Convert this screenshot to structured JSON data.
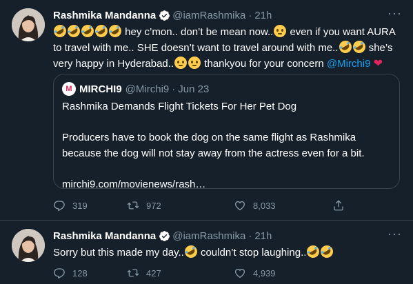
{
  "tweets": [
    {
      "author_name": "Rashmika Mandanna",
      "handle": "@iamRashmika",
      "separator": "·",
      "time": "21h",
      "text": {
        "part1": " hey c’mon.. don’t be mean now..",
        "part2": " even if you want AURA to travel with me.. SHE doesn’t want to travel around with me..",
        "part3": " she’s very happy in Hyderabad..",
        "part4": " thankyou for your concern ",
        "mention": "@Mirchi9"
      },
      "quote": {
        "author_name": "MIRCHI9",
        "handle": "@Mirchi9",
        "separator": "·",
        "date": "Jun 23",
        "headline": "Rashmika Demands Flight Tickets For Her Pet Dog",
        "paragraph": "Producers have to book the dog on the same flight as Rashmika because the dog will not stay away from the actress even for a bit.",
        "link": "mirchi9.com/movienews/rash…"
      },
      "replies": "319",
      "retweets": "972",
      "likes": "8,033"
    },
    {
      "author_name": "Rashmika Mandanna",
      "handle": "@iamRashmika",
      "separator": "·",
      "time": "21h",
      "text": {
        "part1": "Sorry but this made my day..",
        "part2": " couldn’t stop laughing.."
      },
      "replies": "128",
      "retweets": "427",
      "likes": "4,939"
    }
  ],
  "icons": {
    "verified": "verified-badge-icon",
    "more": "more-options-icon",
    "reply": "reply-icon",
    "retweet": "retweet-icon",
    "like": "heart-icon",
    "share": "share-icon",
    "emoji_rofl": "rofl-emoji",
    "emoji_tear": "smiling-tear-emoji",
    "emoji_heart": "red-heart-emoji"
  },
  "colors": {
    "background": "#15202b",
    "text": "#ffffff",
    "muted": "#8899a6",
    "link": "#1da1f2",
    "border": "#38444d",
    "heart": "#e0245e"
  }
}
